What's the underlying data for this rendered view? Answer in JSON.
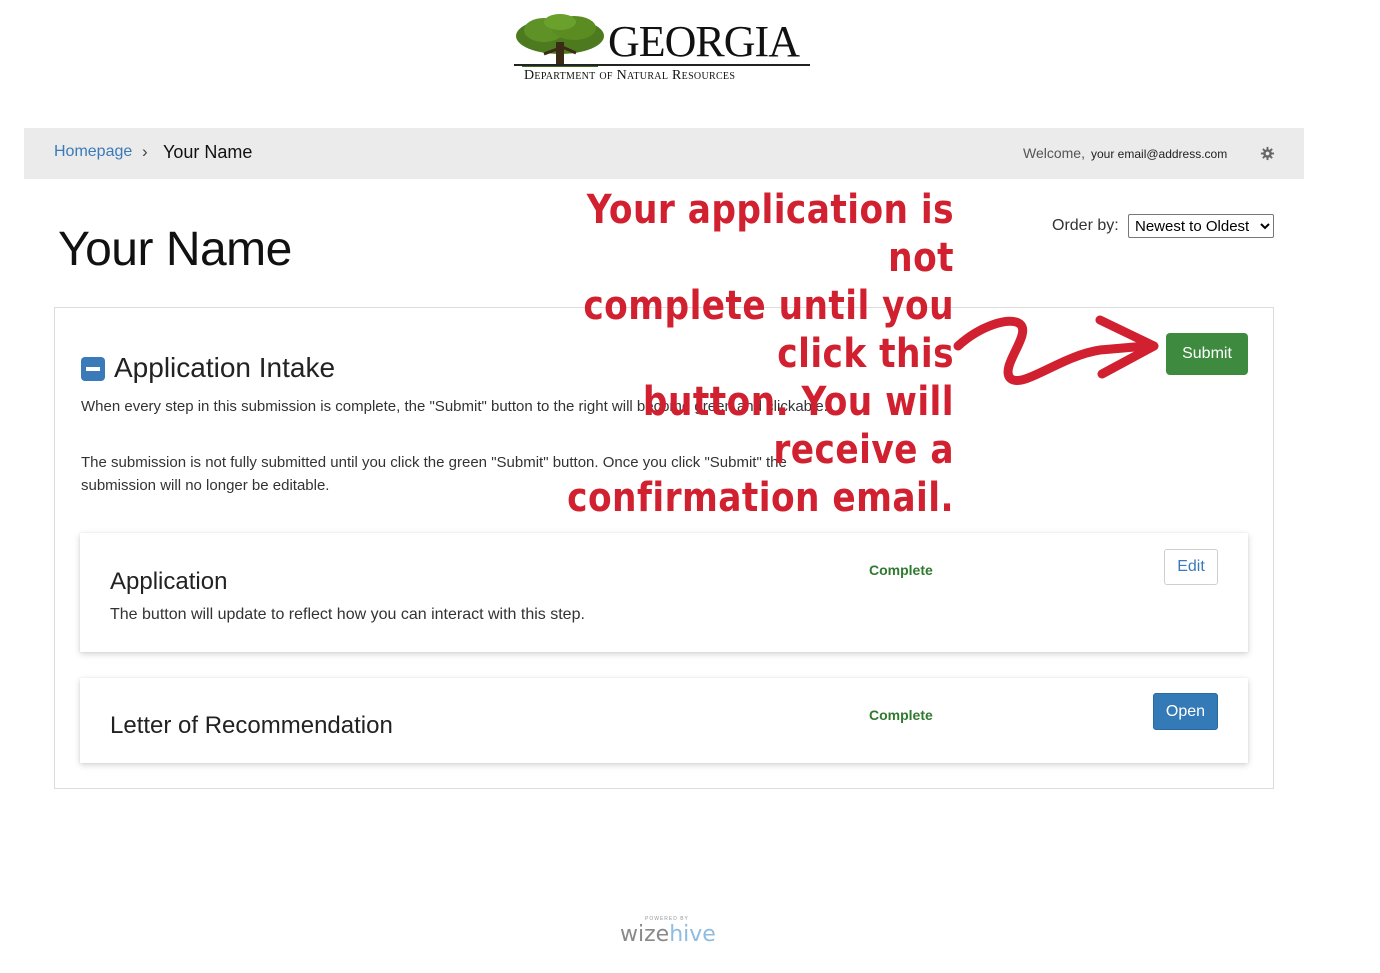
{
  "logo": {
    "title": "GEORGIA",
    "subtitle": "Department of Natural Resources"
  },
  "breadcrumb": {
    "home": "Homepage",
    "separator": "›",
    "current": "Your Name"
  },
  "header": {
    "welcome": "Welcome,",
    "email": "your email@address.com",
    "settings_icon": "gear-icon"
  },
  "page": {
    "title": "Your Name",
    "order_label": "Order by:",
    "order_selected": "Newest to Oldest",
    "order_options": [
      "Newest to Oldest"
    ]
  },
  "annotation": {
    "line1": "Your application is not",
    "line2": "complete until you click this",
    "line3": "button. You will receive a",
    "line4": "confirmation email.",
    "color": "#d1202f"
  },
  "intake": {
    "title": "Application Intake",
    "collapse_icon": "minus-square-icon",
    "para1": "When every step in this submission is complete, the \"Submit\" button to the right will become green and clickable.",
    "para2": "The submission is not fully submitted until you click the green \"Submit\" button. Once you click \"Submit\" the submission will no longer be editable.",
    "submit_label": "Submit"
  },
  "steps": [
    {
      "title": "Application",
      "description": "The button will update to reflect how you can interact with this step.",
      "status": "Complete",
      "button": "Edit"
    },
    {
      "title": "Letter of Recommendation",
      "description": "",
      "status": "Complete",
      "button": "Open"
    }
  ],
  "footer": {
    "powered_by": "POWERED BY",
    "brand_a": "wize",
    "brand_b": "hive"
  },
  "colors": {
    "submit_green": "#3e8a3e",
    "status_green": "#2f7a2f",
    "link_blue": "#3a7ab8",
    "open_blue": "#337ab7"
  }
}
